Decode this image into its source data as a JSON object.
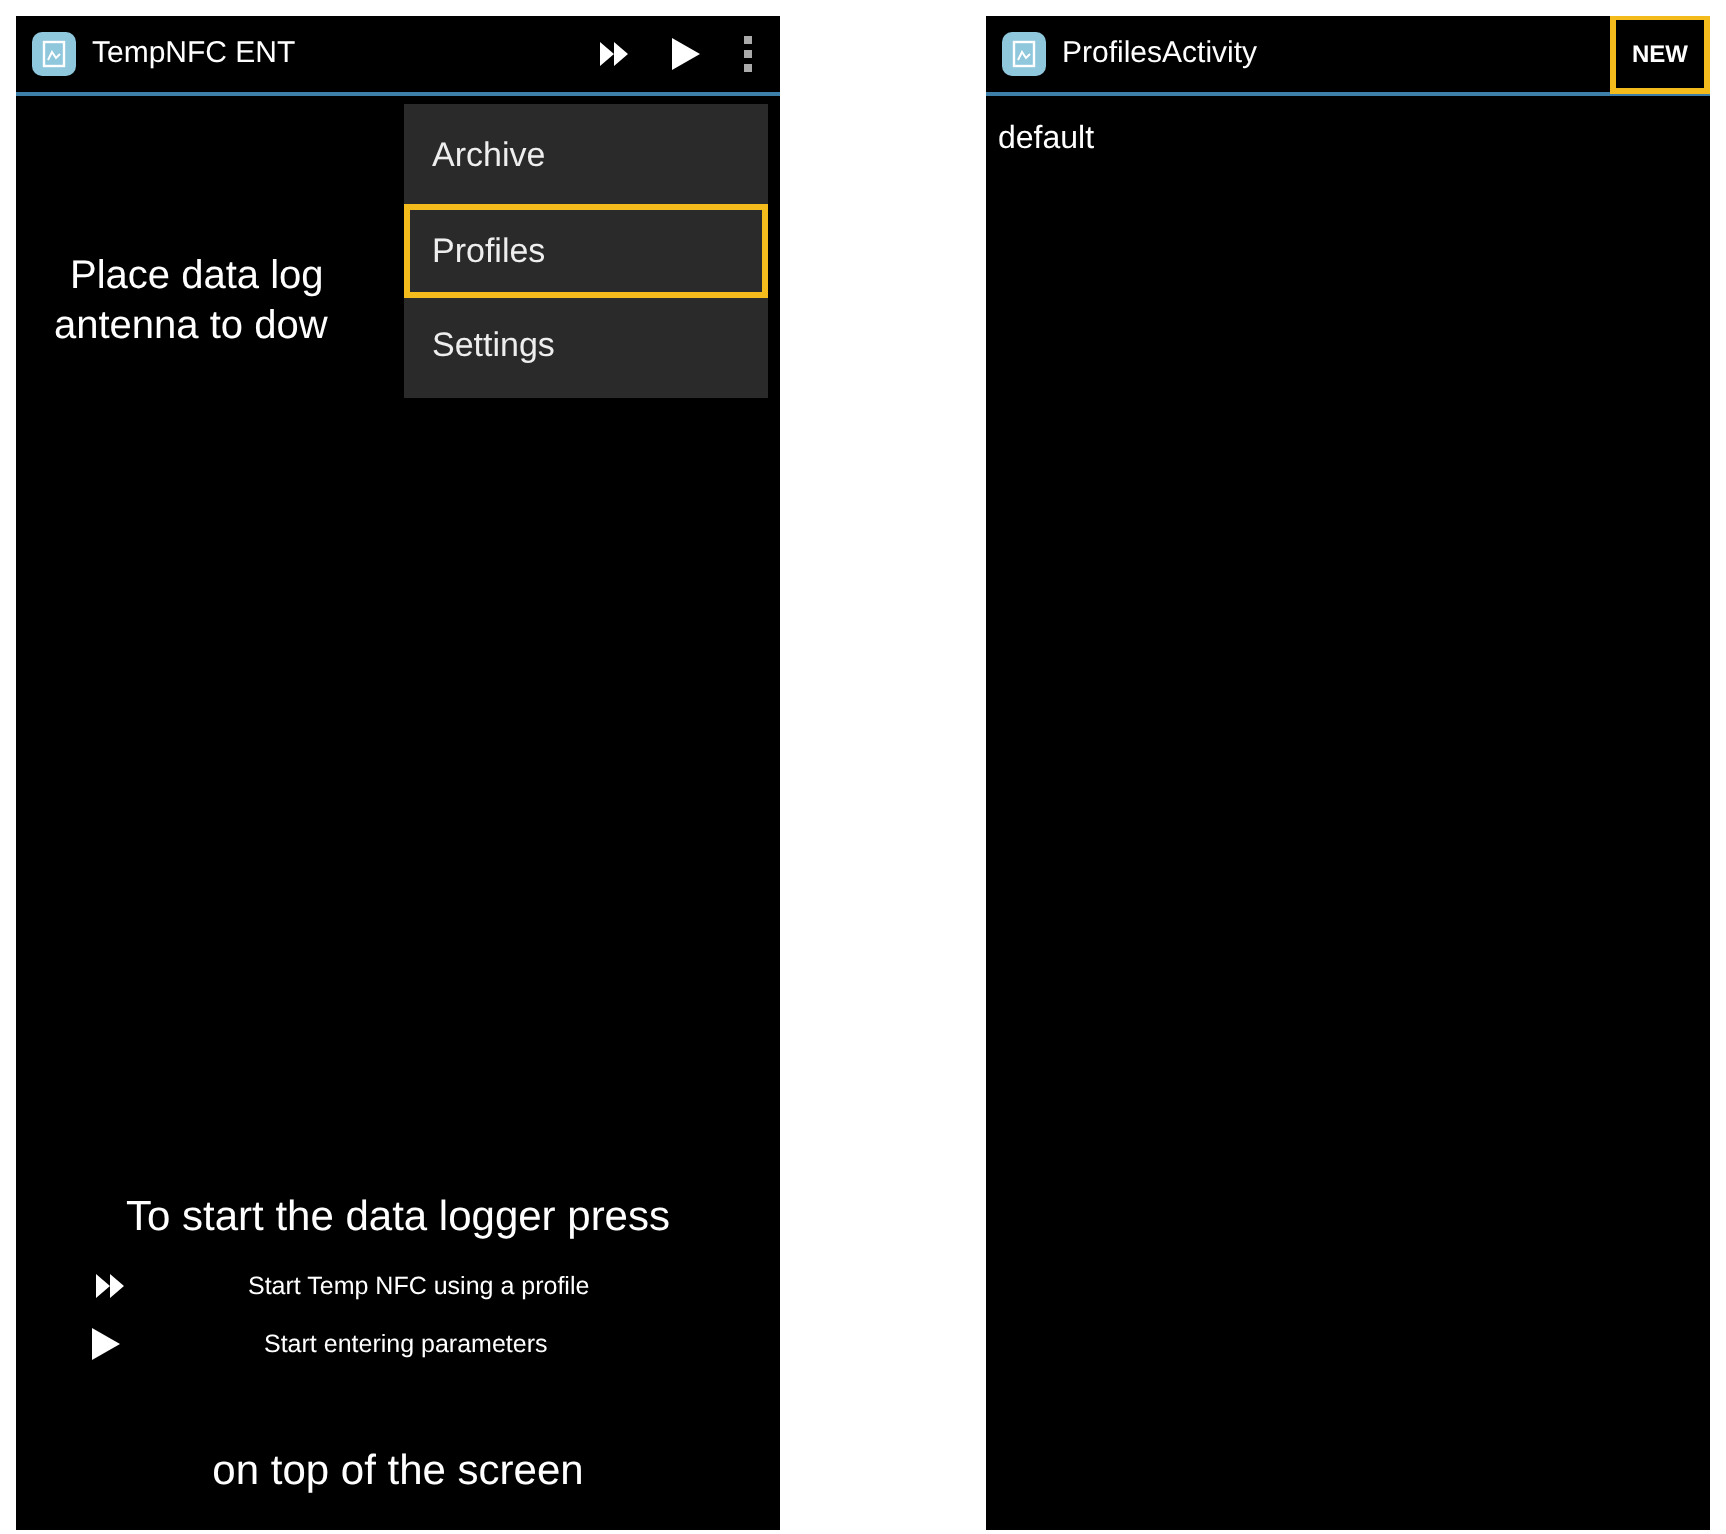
{
  "screens": [
    {
      "kind": "main",
      "title": "TempNFC ENT",
      "actions": [
        {
          "kind": "fast-forward"
        },
        {
          "kind": "play"
        },
        {
          "kind": "overflow"
        }
      ],
      "intro": [
        "Place data log",
        "antenna to dow"
      ],
      "menu": [
        {
          "label": "Archive",
          "highlighted": false
        },
        {
          "label": "Profiles",
          "highlighted": true
        },
        {
          "label": "Settings",
          "highlighted": false
        }
      ],
      "heading": "To start the data logger press",
      "legend": [
        {
          "kind": "fast-forward",
          "text": "Start Temp NFC using a profile"
        },
        {
          "kind": "play",
          "text": "Start entering parameters"
        }
      ],
      "footer": "on top of the screen"
    },
    {
      "kind": "list",
      "title": "ProfilesActivity",
      "button": {
        "label": "NEW",
        "highlighted": true
      },
      "items": [
        "default"
      ]
    }
  ]
}
